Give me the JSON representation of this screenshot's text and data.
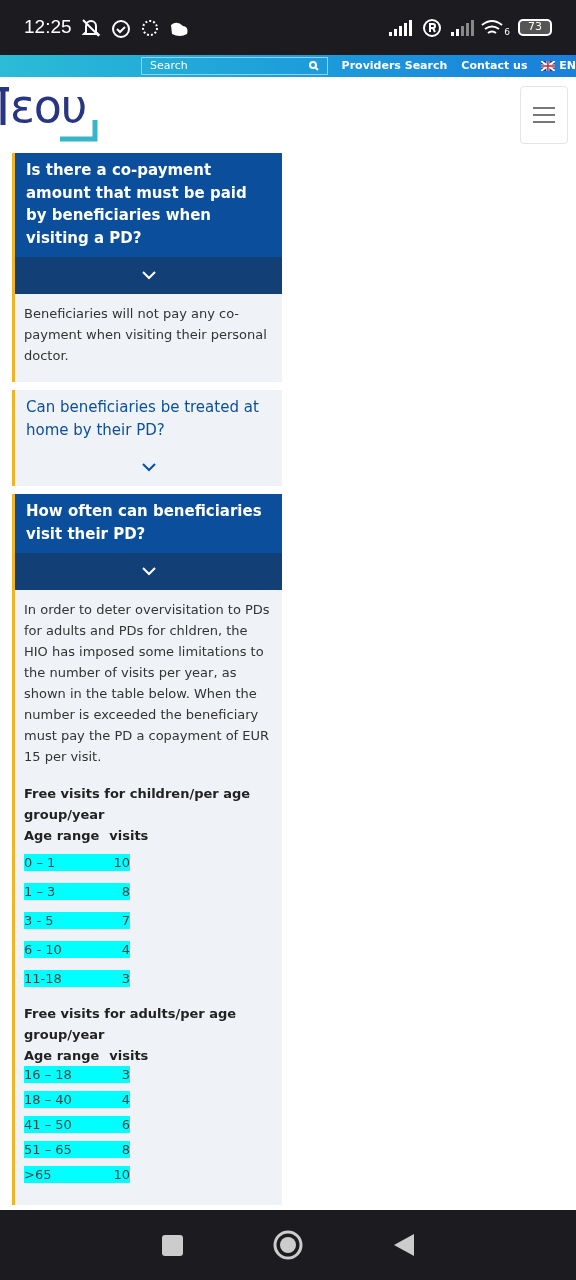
{
  "status_bar": {
    "time": "12:25",
    "battery": "73",
    "wifi_band": "6"
  },
  "top_bar": {
    "search": {
      "placeholder": "Search"
    },
    "links": [
      "Providers Search",
      "Contact us"
    ],
    "language": "EN"
  },
  "header": {
    "logo": "εου"
  },
  "faq": [
    {
      "question": "Is there a co-payment amount that must be paid by beneficiaries when visiting a PD?",
      "expanded": true,
      "answer": "Beneficiaries will not pay any co-payment when visiting their personal doctor."
    },
    {
      "question": "Can beneficiaries be treated at home by their PD?",
      "expanded": false
    },
    {
      "question": "How often can beneficiaries visit their PD?",
      "expanded": true,
      "answer": "In order to deter overvisitation to PDs for adults and PDs for chldren, the HIO has imposed some limitations to the number of visits per year, as shown in the table below. When the number is exceeded the beneficiary must pay the PD a copayment of EUR 15 per visit.",
      "tables": [
        {
          "title": "Free visits for children/per age group/year",
          "header": [
            "Age range",
            "visits"
          ],
          "rows": [
            [
              "0 – 1",
              "10"
            ],
            [
              "1 – 3",
              "8"
            ],
            [
              "3 - 5",
              "7"
            ],
            [
              "6 - 10",
              "4"
            ],
            [
              "11-18",
              "3"
            ]
          ]
        },
        {
          "title": "Free visits for adults/per age group/year",
          "header": [
            "Age range",
            "visits"
          ],
          "rows": [
            [
              "16 – 18",
              "3"
            ],
            [
              "18 – 40",
              "4"
            ],
            [
              "41 – 50",
              "6"
            ],
            [
              "51 – 65",
              "8"
            ],
            [
              ">65",
              "10"
            ]
          ]
        }
      ]
    }
  ]
}
